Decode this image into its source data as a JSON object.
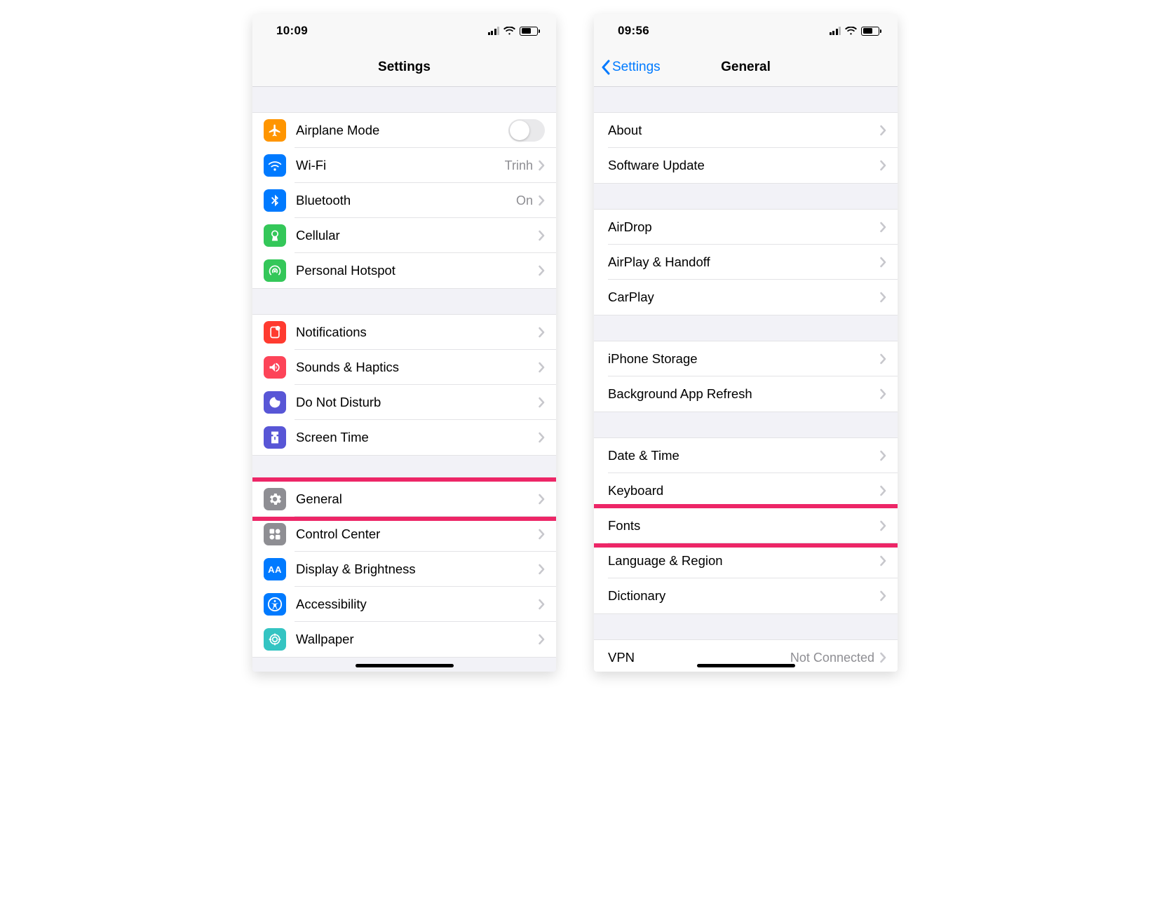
{
  "left": {
    "time": "10:09",
    "title": "Settings",
    "groups": [
      [
        {
          "icon": "airplane",
          "bg": "orange",
          "label": "Airplane Mode",
          "control": "toggle",
          "toggle": false
        },
        {
          "icon": "wifi",
          "bg": "blue",
          "label": "Wi-Fi",
          "value": "Trinh",
          "chevron": true
        },
        {
          "icon": "bluetooth",
          "bg": "blue",
          "label": "Bluetooth",
          "value": "On",
          "chevron": true
        },
        {
          "icon": "cellular",
          "bg": "green",
          "label": "Cellular",
          "chevron": true
        },
        {
          "icon": "hotspot",
          "bg": "green",
          "label": "Personal Hotspot",
          "chevron": true
        }
      ],
      [
        {
          "icon": "notifications",
          "bg": "red",
          "label": "Notifications",
          "chevron": true
        },
        {
          "icon": "sounds",
          "bg": "red2",
          "label": "Sounds & Haptics",
          "chevron": true
        },
        {
          "icon": "dnd",
          "bg": "purple",
          "label": "Do Not Disturb",
          "chevron": true
        },
        {
          "icon": "screentime",
          "bg": "purple",
          "label": "Screen Time",
          "chevron": true
        }
      ],
      [
        {
          "icon": "general",
          "bg": "gray",
          "label": "General",
          "chevron": true,
          "highlight": true
        },
        {
          "icon": "controlcenter",
          "bg": "gray",
          "label": "Control Center",
          "chevron": true
        },
        {
          "icon": "display",
          "bg": "blue",
          "label": "Display & Brightness",
          "chevron": true
        },
        {
          "icon": "accessibility",
          "bg": "blue",
          "label": "Accessibility",
          "chevron": true
        },
        {
          "icon": "wallpaper",
          "bg": "teal",
          "label": "Wallpaper",
          "chevron": true
        }
      ]
    ]
  },
  "right": {
    "time": "09:56",
    "back": "Settings",
    "title": "General",
    "groups": [
      [
        {
          "label": "About",
          "chevron": true
        },
        {
          "label": "Software Update",
          "chevron": true
        }
      ],
      [
        {
          "label": "AirDrop",
          "chevron": true
        },
        {
          "label": "AirPlay & Handoff",
          "chevron": true
        },
        {
          "label": "CarPlay",
          "chevron": true
        }
      ],
      [
        {
          "label": "iPhone Storage",
          "chevron": true
        },
        {
          "label": "Background App Refresh",
          "chevron": true
        }
      ],
      [
        {
          "label": "Date & Time",
          "chevron": true
        },
        {
          "label": "Keyboard",
          "chevron": true
        },
        {
          "label": "Fonts",
          "chevron": true,
          "highlight": true
        },
        {
          "label": "Language & Region",
          "chevron": true
        },
        {
          "label": "Dictionary",
          "chevron": true
        }
      ],
      [
        {
          "label": "VPN",
          "value": "Not Connected",
          "chevron": true
        }
      ]
    ]
  }
}
